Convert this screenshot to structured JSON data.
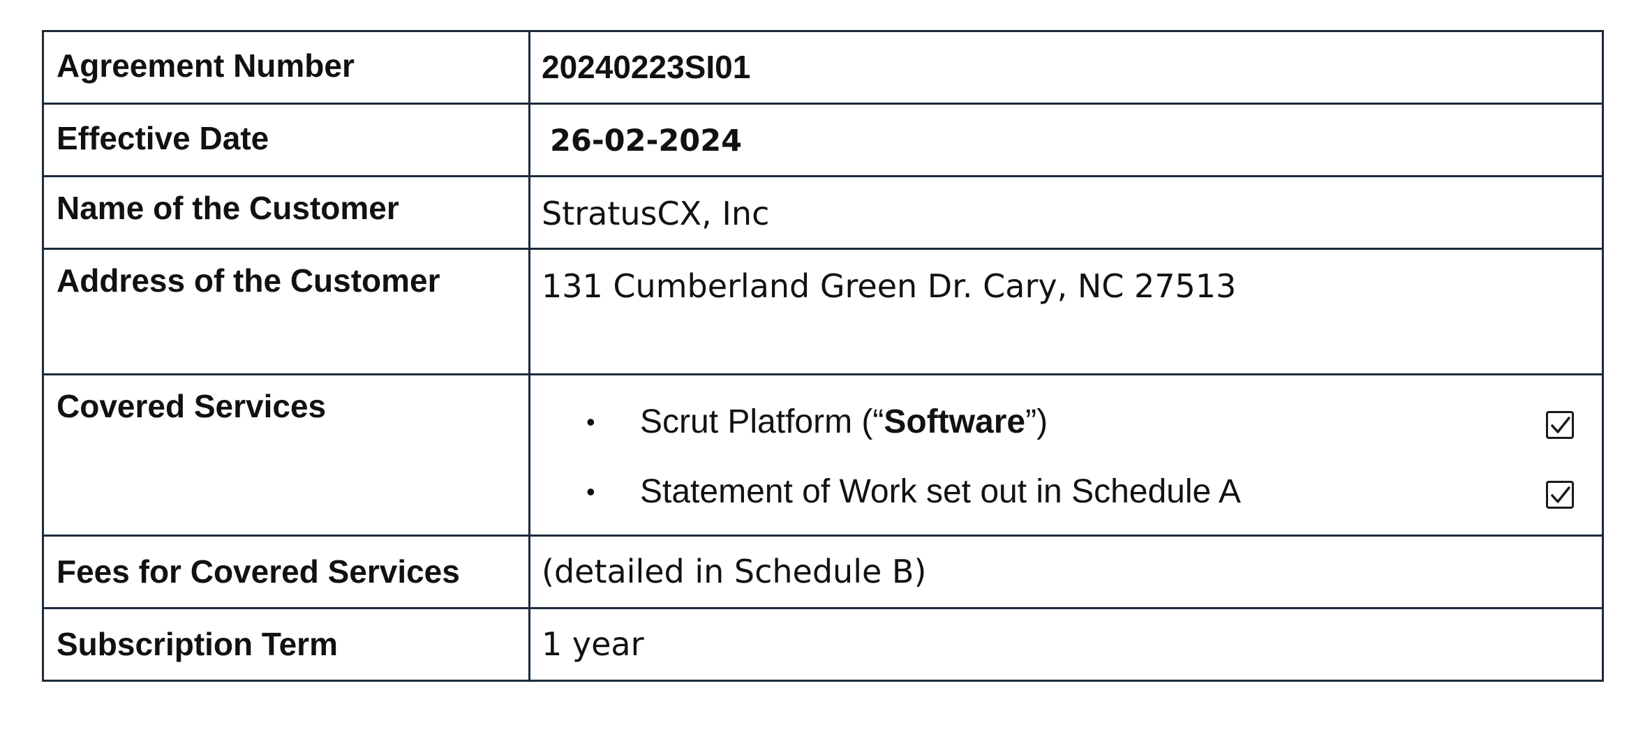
{
  "rows": {
    "agreement_number": {
      "label": "Agreement Number",
      "value": "20240223SI01"
    },
    "effective_date": {
      "label": "Effective Date",
      "value": "26-02-2024"
    },
    "customer_name": {
      "label": "Name of the Customer",
      "value": "StratusCX, Inc"
    },
    "customer_address": {
      "label": "Address of the Customer",
      "value": "131 Cumberland Green Dr. Cary, NC 27513"
    },
    "covered_services": {
      "label": "Covered Services",
      "items": [
        {
          "bullet": "•",
          "text_before": "Scrut Platform (“",
          "text_bold": "Software",
          "text_after": "”)",
          "checked": true
        },
        {
          "bullet": "•",
          "text_before": "Statement of Work set out in Schedule A",
          "text_bold": "",
          "text_after": "",
          "checked": true
        }
      ]
    },
    "fees": {
      "label": "Fees for Covered Services",
      "value": "(detailed in Schedule B)"
    },
    "subscription_term": {
      "label": "Subscription Term",
      "value": "1 year"
    }
  },
  "colors": {
    "border": "#1c2a3a",
    "text": "#111111"
  },
  "icons": {
    "checkbox": "checkbox-checked-icon"
  }
}
